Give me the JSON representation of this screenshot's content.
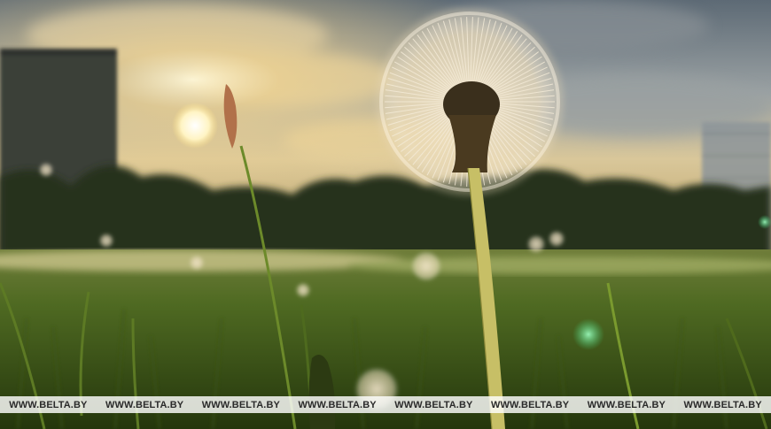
{
  "watermark": {
    "items": [
      "WWW.BELTA.BY",
      "WWW.BELTA.BY",
      "WWW.BELTA.BY",
      "WWW.BELTA.BY",
      "WWW.BELTA.BY",
      "WWW.BELTA.BY",
      "WWW.BELTA.BY",
      "WWW.BELTA.BY"
    ]
  }
}
